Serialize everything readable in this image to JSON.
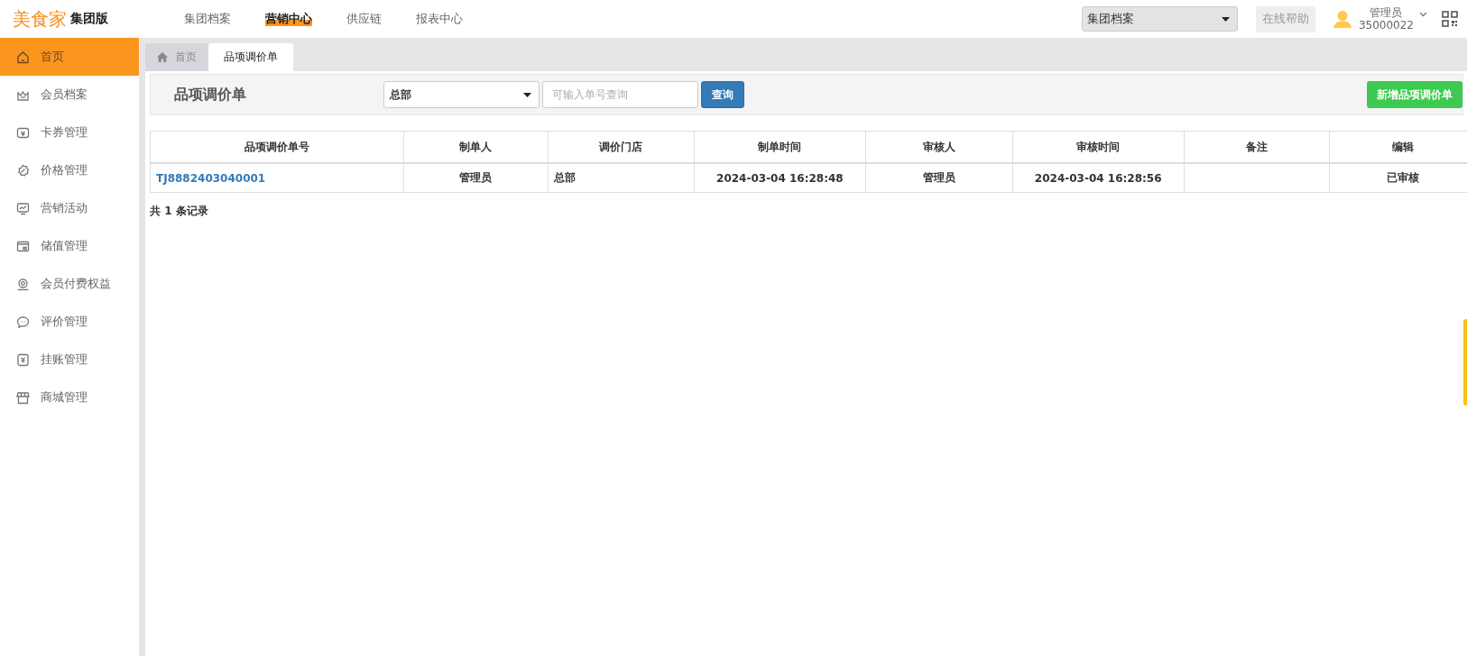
{
  "header": {
    "logo": "美食家",
    "edition": "集团版",
    "nav": [
      {
        "label": "集团档案",
        "selected": false
      },
      {
        "label": "营销中心",
        "selected": true
      },
      {
        "label": "供应链",
        "selected": false
      },
      {
        "label": "报表中心",
        "selected": false
      }
    ],
    "org_select": {
      "value": "集团档案"
    },
    "help_button": "在线帮助",
    "user": {
      "name": "管理员",
      "id": "35000022"
    }
  },
  "sidebar": {
    "items": [
      {
        "label": "首页",
        "selected": true
      },
      {
        "label": "会员档案",
        "selected": false
      },
      {
        "label": "卡券管理",
        "selected": false
      },
      {
        "label": "价格管理",
        "selected": false
      },
      {
        "label": "营销活动",
        "selected": false
      },
      {
        "label": "储值管理",
        "selected": false
      },
      {
        "label": "会员付费权益",
        "selected": false
      },
      {
        "label": "评价管理",
        "selected": false
      },
      {
        "label": "挂账管理",
        "selected": false
      },
      {
        "label": "商城管理",
        "selected": false
      }
    ]
  },
  "tabs": [
    {
      "label": "首页",
      "kind": "home",
      "selected": false
    },
    {
      "label": "品项调价单",
      "kind": "page",
      "selected": true
    }
  ],
  "toolbar": {
    "title": "品项调价单",
    "store_select": {
      "value": "总部"
    },
    "search": {
      "placeholder": "可输入单号查询"
    },
    "search_button": "查询",
    "add_button": "新增品项调价单"
  },
  "table": {
    "columns": [
      "品项调价单号",
      "制单人",
      "调价门店",
      "制单时间",
      "审核人",
      "审核时间",
      "备注",
      "编辑"
    ],
    "rows": [
      [
        {
          "text": "TJ8882403040001",
          "kind": "link"
        },
        {
          "text": "管理员",
          "kind": "text"
        },
        {
          "text": "总部",
          "kind": "text"
        },
        {
          "text": "2024-03-04 16:28:48",
          "kind": "text"
        },
        {
          "text": "管理员",
          "kind": "text"
        },
        {
          "text": "2024-03-04 16:28:56",
          "kind": "text"
        },
        {
          "text": "",
          "kind": "text"
        },
        {
          "text": "已审核",
          "kind": "text"
        }
      ]
    ]
  },
  "footer": "共 1 条记录"
}
